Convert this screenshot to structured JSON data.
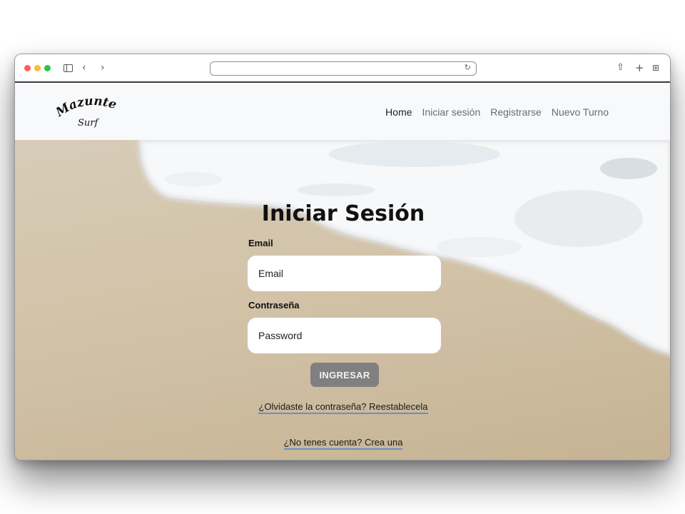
{
  "browser": {
    "back_icon": "chevron-left-icon",
    "forward_icon": "chevron-right-icon",
    "back_glyph": "‹",
    "forward_glyph": "›",
    "reload_glyph": "↻",
    "share_glyph": "⇧",
    "newtab_glyph": "+",
    "tabs_glyph": "⊞"
  },
  "site": {
    "logo_line1": "Mazunte",
    "logo_line2": "Surf",
    "nav": [
      {
        "label": "Home"
      },
      {
        "label": "Iniciar sesión"
      },
      {
        "label": "Registrarse"
      },
      {
        "label": "Nuevo Turno"
      }
    ]
  },
  "login": {
    "title": "Iniciar Sesión",
    "email_label": "Email",
    "email_placeholder": "Email",
    "password_label": "Contraseña",
    "password_placeholder": "Password",
    "submit_label": "INGRESAR",
    "forgot_link": "¿Olvidaste la contraseña? Reestablecela",
    "register_link": "¿No tenes cuenta? Crea una"
  },
  "colors": {
    "button_bg": "#808080",
    "link_underline": "#6a8fc9",
    "navbar_bg": "#f8f9fb"
  }
}
